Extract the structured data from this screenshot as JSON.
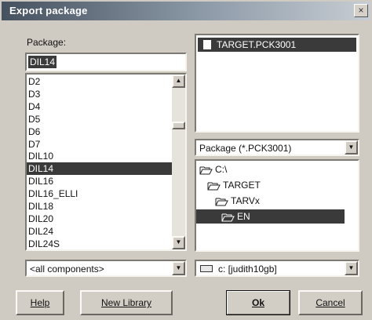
{
  "window": {
    "title": "Export package",
    "close_glyph": "×"
  },
  "package_label": "Package:",
  "package_input_value": "DIL14",
  "components": [
    "D2",
    "D3",
    "D4",
    "D5",
    "D6",
    "D7",
    "DIL10",
    "DIL14",
    "DIL16",
    "DIL16_ELLI",
    "DIL18",
    "DIL20",
    "DIL24",
    "DIL24S"
  ],
  "selected_component": "DIL14",
  "component_filter": {
    "value": "<all components>"
  },
  "files": [
    {
      "name": "TARGET.PCK3001",
      "selected": true
    }
  ],
  "file_type": {
    "value": "Package (*.PCK3001)"
  },
  "directories": [
    {
      "name": "C:\\",
      "level": 0,
      "open": true,
      "selected": false
    },
    {
      "name": "TARGET",
      "level": 1,
      "open": true,
      "selected": false
    },
    {
      "name": "TARVx",
      "level": 2,
      "open": true,
      "selected": false
    },
    {
      "name": "EN",
      "level": 3,
      "open": true,
      "selected": true
    }
  ],
  "drive": {
    "value": "c: [judith10gb]"
  },
  "buttons": {
    "help": "Help",
    "new_library": "New Library",
    "ok": "Ok",
    "cancel": "Cancel"
  },
  "icons": {
    "close": "close-icon",
    "scroll_up": "arrow-up-icon",
    "scroll_down": "arrow-down-icon",
    "dropdown": "chevron-down-icon",
    "file": "document-icon",
    "folder": "folder-open-icon",
    "drive": "drive-icon"
  },
  "colors": {
    "selection": "#3a3a3a",
    "face": "#cfcbc2",
    "title_start": "#45515f"
  }
}
